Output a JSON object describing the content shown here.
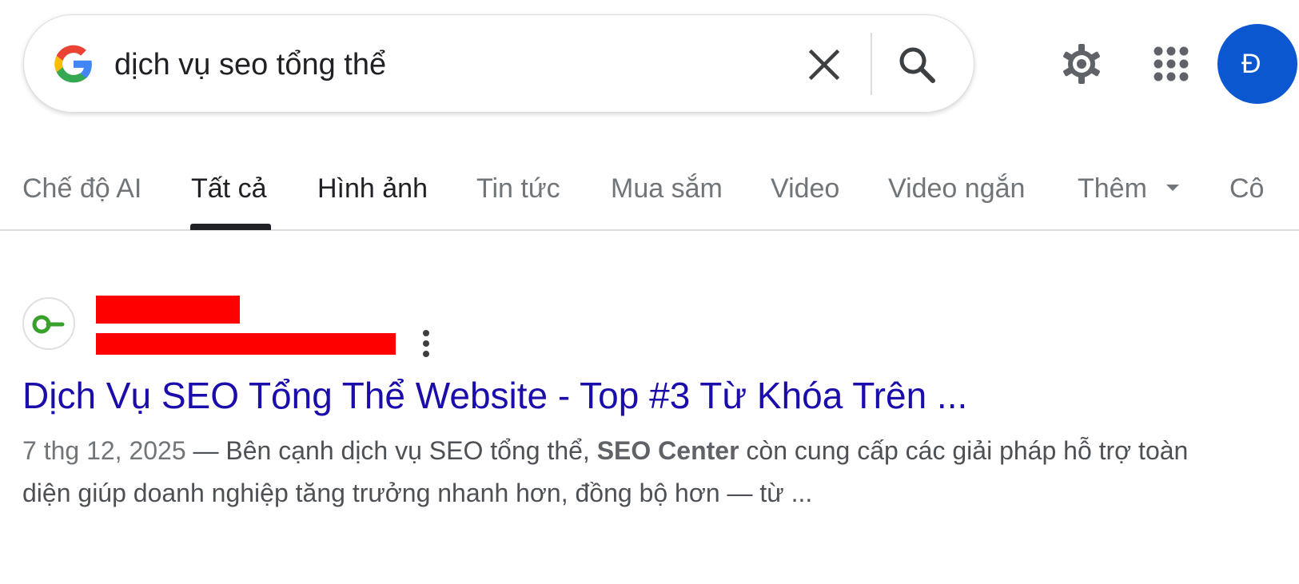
{
  "search": {
    "query": "dịch vụ seo tổng thể",
    "clear_icon": "close-icon",
    "search_icon": "search-icon"
  },
  "header": {
    "settings_icon": "gear-icon",
    "apps_icon": "apps-grid-icon",
    "avatar_letter": "Đ"
  },
  "tabs": [
    {
      "label": "Chế độ AI"
    },
    {
      "label": "Tất cả",
      "active": true
    },
    {
      "label": "Hình ảnh"
    },
    {
      "label": "Tin tức"
    },
    {
      "label": "Mua sắm"
    },
    {
      "label": "Video"
    },
    {
      "label": "Video ngắn"
    },
    {
      "label": "Thêm"
    },
    {
      "label": "Cô"
    }
  ],
  "result": {
    "favicon_icon": "site-key-logo-icon",
    "site_name": "",
    "site_url": "",
    "title": "Dịch Vụ SEO Tổng Thể Website - Top #3 Từ Khóa Trên ...",
    "snippet_date": "7 thg 12, 2025",
    "snippet_sep": " — ",
    "snippet_part1": "Bên cạnh dịch vụ SEO tổng thể, ",
    "snippet_bold": "SEO Center",
    "snippet_part2": " còn cung cấp các giải pháp hỗ trợ toàn",
    "snippet_line2": "diện giúp doanh nghiệp tăng trưởng nhanh hơn, đồng bộ hơn — từ ..."
  },
  "colors": {
    "link": "#1a0dab",
    "avatar": "#0b57d0",
    "redaction": "#ff0000"
  }
}
